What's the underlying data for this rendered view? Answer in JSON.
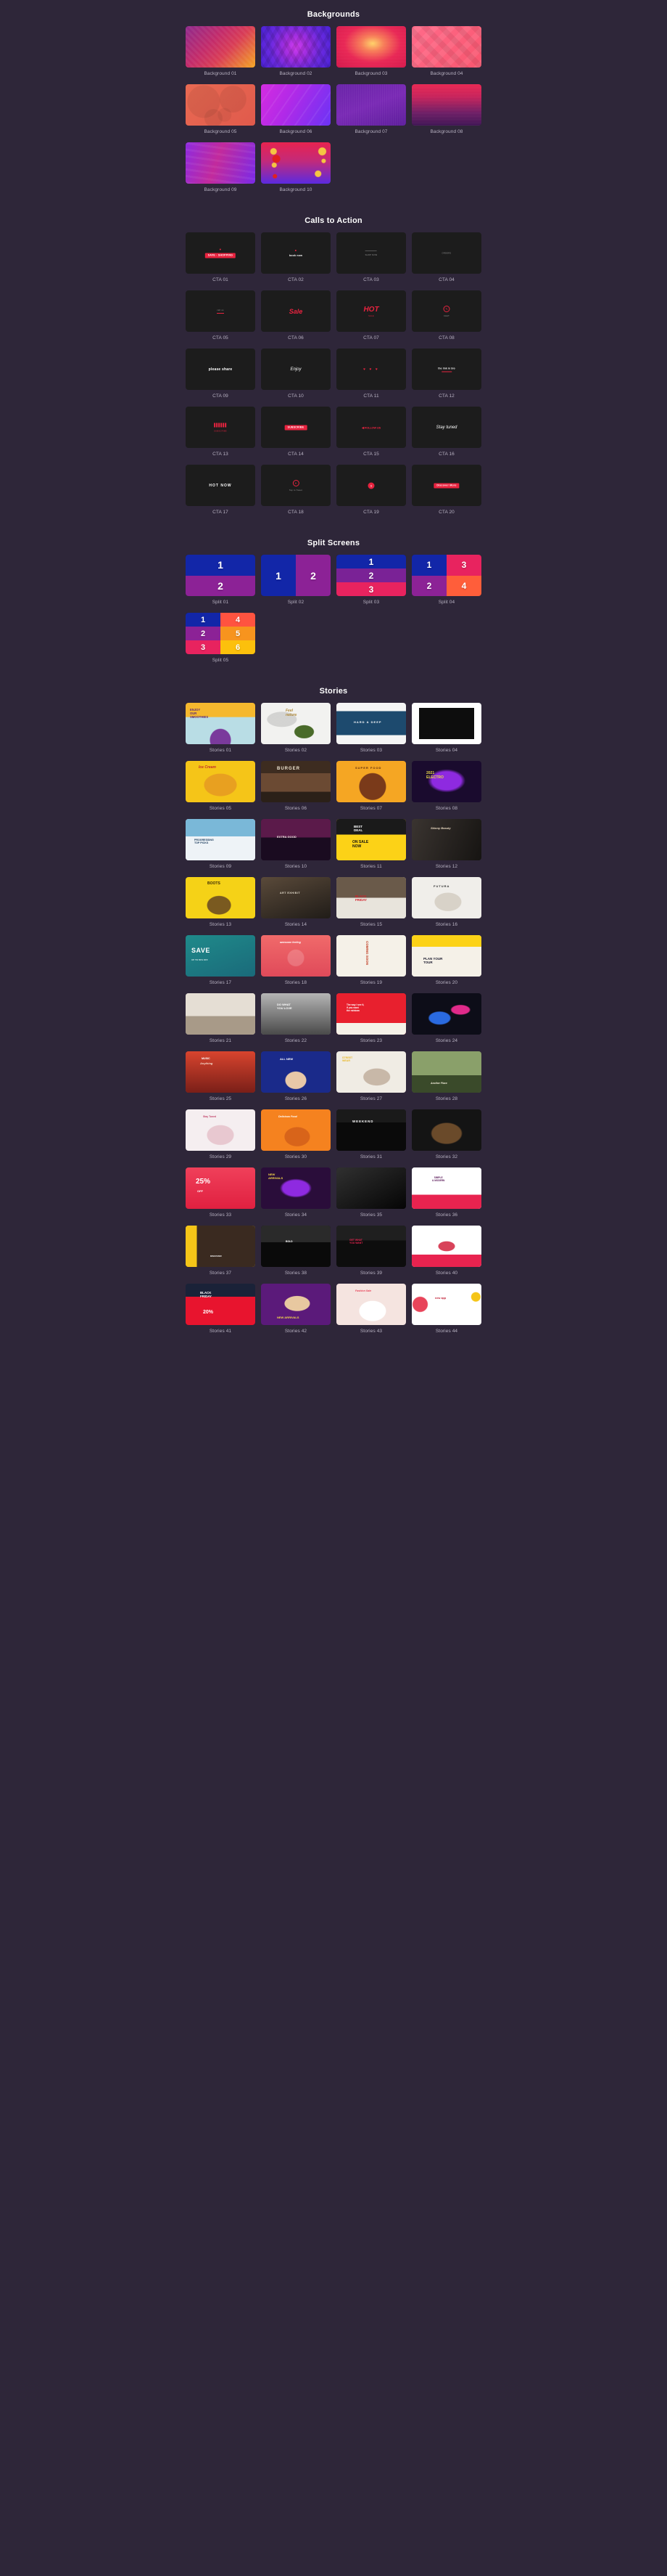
{
  "sections": [
    {
      "id": "backgrounds",
      "title": "Backgrounds",
      "items": [
        {
          "label": "Background 01",
          "kind": "bg",
          "style": "bg01"
        },
        {
          "label": "Background 02",
          "kind": "bg",
          "style": "bg02"
        },
        {
          "label": "Background 03",
          "kind": "bg",
          "style": "bg03"
        },
        {
          "label": "Background 04",
          "kind": "bg",
          "style": "bg04"
        },
        {
          "label": "Background 05",
          "kind": "bg",
          "style": "bg05"
        },
        {
          "label": "Background 06",
          "kind": "bg",
          "style": "bg06"
        },
        {
          "label": "Background 07",
          "kind": "bg",
          "style": "bg07"
        },
        {
          "label": "Background 08",
          "kind": "bg",
          "style": "bg08"
        },
        {
          "label": "Background 09",
          "kind": "bg",
          "style": "bg09"
        },
        {
          "label": "Background 10",
          "kind": "bg",
          "style": "bg10"
        }
      ]
    },
    {
      "id": "calls-to-action",
      "title": "Calls to Action",
      "items": [
        {
          "label": "CTA 01",
          "kind": "cta",
          "mark": "pill",
          "text": "SAVE · SHOPPING"
        },
        {
          "label": "CTA 02",
          "kind": "cta",
          "mark": "dot-text",
          "text": "book now"
        },
        {
          "label": "CTA 03",
          "kind": "cta",
          "mark": "line-sub",
          "text": "SHOP NOW"
        },
        {
          "label": "CTA 04",
          "kind": "cta",
          "mark": "small-caps",
          "text": "ORDERS"
        },
        {
          "label": "CTA 05",
          "kind": "cta",
          "mark": "tiny-line",
          "text": "call us"
        },
        {
          "label": "CTA 06",
          "kind": "cta",
          "mark": "big-italic",
          "text": "Sale"
        },
        {
          "label": "CTA 07",
          "kind": "cta",
          "mark": "stack-red",
          "text": "HOT"
        },
        {
          "label": "CTA 08",
          "kind": "cta",
          "mark": "bubble",
          "text": "CHAT"
        },
        {
          "label": "CTA 09",
          "kind": "cta",
          "mark": "pill-white",
          "text": "please share"
        },
        {
          "label": "CTA 10",
          "kind": "cta",
          "mark": "script",
          "text": "Enjoy"
        },
        {
          "label": "CTA 11",
          "kind": "cta",
          "mark": "hearts",
          "text": "♥ ♥ ♥"
        },
        {
          "label": "CTA 12",
          "kind": "cta",
          "mark": "two-line",
          "text": "the link in bio"
        },
        {
          "label": "CTA 13",
          "kind": "cta",
          "mark": "grid-red",
          "text": "SUBSCRIBE"
        },
        {
          "label": "CTA 14",
          "kind": "cta",
          "mark": "banner",
          "text": "SUBSCRIBE"
        },
        {
          "label": "CTA 15",
          "kind": "cta",
          "mark": "arrow-tag",
          "text": "FOLLOW US"
        },
        {
          "label": "CTA 16",
          "kind": "cta",
          "mark": "script-white",
          "text": "Stay tuned"
        },
        {
          "label": "CTA 17",
          "kind": "cta",
          "mark": "outline",
          "text": "HOT NOW"
        },
        {
          "label": "CTA 18",
          "kind": "cta",
          "mark": "circle-icon",
          "text": "Tap to Tweet"
        },
        {
          "label": "CTA 19",
          "kind": "cta",
          "mark": "bubble-red",
          "text": "SALE"
        },
        {
          "label": "CTA 20",
          "kind": "cta",
          "mark": "stack-sale",
          "text": "Discover More"
        }
      ]
    },
    {
      "id": "split-screens",
      "title": "Split Screens",
      "items": [
        {
          "label": "Split 01",
          "kind": "split",
          "layout": "sp-1",
          "panels": [
            {
              "n": "1",
              "color": "#1226a8"
            },
            {
              "n": "2",
              "color": "#8c2296"
            }
          ]
        },
        {
          "label": "Split 02",
          "kind": "split",
          "layout": "sp-2",
          "panels": [
            {
              "n": "1",
              "color": "#1226a8"
            },
            {
              "n": "2",
              "color": "#8c2296"
            }
          ]
        },
        {
          "label": "Split 03",
          "kind": "split",
          "layout": "sp-3",
          "panels": [
            {
              "n": "1",
              "color": "#1226a8"
            },
            {
              "n": "2",
              "color": "#7a2296"
            },
            {
              "n": "3",
              "color": "#e8235f"
            }
          ]
        },
        {
          "label": "Split 04",
          "kind": "split",
          "layout": "sp-4",
          "panels": [
            {
              "n": "1",
              "color": "#1226a8"
            },
            {
              "n": "3",
              "color": "#e8235f"
            },
            {
              "n": "2",
              "color": "#8c2296"
            },
            {
              "n": "4",
              "color": "#ff5e3a"
            }
          ]
        },
        {
          "label": "Split 05",
          "kind": "split",
          "layout": "sp-5",
          "panels": [
            {
              "n": "1",
              "color": "#1226a8"
            },
            {
              "n": "4",
              "color": "#ff5340"
            },
            {
              "n": "2",
              "color": "#8c2296"
            },
            {
              "n": "5",
              "color": "#f7941e"
            },
            {
              "n": "3",
              "color": "#e8235f"
            },
            {
              "n": "6",
              "color": "#fcc00c"
            }
          ]
        }
      ]
    },
    {
      "id": "stories",
      "title": "Stories",
      "items": [
        {
          "label": "Stories 01",
          "kind": "story",
          "style": "s01",
          "text": "ENJOY OUR SMOOTHIES"
        },
        {
          "label": "Stories 02",
          "kind": "story",
          "style": "s02",
          "text": "Feel nature"
        },
        {
          "label": "Stories 03",
          "kind": "story",
          "style": "s03",
          "text": "HARD & DEEP"
        },
        {
          "label": "Stories 04",
          "kind": "story",
          "style": "s04",
          "text": ""
        },
        {
          "label": "Stories 05",
          "kind": "story",
          "style": "s05",
          "text": "Ice Cream"
        },
        {
          "label": "Stories 06",
          "kind": "story",
          "style": "s06",
          "text": "BURGER"
        },
        {
          "label": "Stories 07",
          "kind": "story",
          "style": "s07",
          "text": "FOOD"
        },
        {
          "label": "Stories 08",
          "kind": "story",
          "style": "s08",
          "text": "2021 ELECTRO MUSIC"
        },
        {
          "label": "Stories 09",
          "kind": "story",
          "style": "s09",
          "text": "PROGRESSING TOP PICKS"
        },
        {
          "label": "Stories 10",
          "kind": "story",
          "style": "s10",
          "text": "EXTRA GOOD BUSINESS"
        },
        {
          "label": "Stories 11",
          "kind": "story",
          "style": "s11",
          "text": "BEST DEAL ON SALE NOW"
        },
        {
          "label": "Stories 12",
          "kind": "story",
          "style": "s12",
          "text": "Skinny Beauty"
        },
        {
          "label": "Stories 13",
          "kind": "story",
          "style": "s13",
          "text": "BOOTS"
        },
        {
          "label": "Stories 14",
          "kind": "story",
          "style": "s14",
          "text": "ART EXHIBIT"
        },
        {
          "label": "Stories 15",
          "kind": "story",
          "style": "s15",
          "text": "BLACK FRIDAY"
        },
        {
          "label": "Stories 16",
          "kind": "story",
          "style": "s16",
          "text": "FUTURA"
        },
        {
          "label": "Stories 17",
          "kind": "story",
          "style": "s17",
          "text": "SAVE"
        },
        {
          "label": "Stories 18",
          "kind": "story",
          "style": "s18",
          "text": "awesome feeling"
        },
        {
          "label": "Stories 19",
          "kind": "story",
          "style": "s19",
          "text": "COMING SOON"
        },
        {
          "label": "Stories 20",
          "kind": "story",
          "style": "s20",
          "text": "PLAN YOUR TOUR"
        },
        {
          "label": "Stories 21",
          "kind": "story",
          "style": "s21",
          "text": ""
        },
        {
          "label": "Stories 22",
          "kind": "story",
          "style": "s22",
          "text": "DO WHAT YOU LOVE"
        },
        {
          "label": "Stories 23",
          "kind": "story",
          "style": "s23",
          "text": "The way I see it, if you want the rainbow"
        },
        {
          "label": "Stories 24",
          "kind": "story",
          "style": "s24",
          "text": ""
        },
        {
          "label": "Stories 25",
          "kind": "story",
          "style": "s25",
          "text": "MUSIC Anything"
        },
        {
          "label": "Stories 26",
          "kind": "story",
          "style": "s26",
          "text": "ALL NEW"
        },
        {
          "label": "Stories 27",
          "kind": "story",
          "style": "s27",
          "text": "STREET WEAR"
        },
        {
          "label": "Stories 28",
          "kind": "story",
          "style": "s28",
          "text": "Another Place"
        },
        {
          "label": "Stories 29",
          "kind": "story",
          "style": "s29",
          "text": "Stay Tuned"
        },
        {
          "label": "Stories 30",
          "kind": "story",
          "style": "s30",
          "text": "Delicious Food"
        },
        {
          "label": "Stories 31",
          "kind": "story",
          "style": "s31",
          "text": "WEEKEND"
        },
        {
          "label": "Stories 32",
          "kind": "story",
          "style": "s32",
          "text": ""
        },
        {
          "label": "Stories 33",
          "kind": "story",
          "style": "s33",
          "text": "25% OFF"
        },
        {
          "label": "Stories 34",
          "kind": "story",
          "style": "s34",
          "text": "NEW ARRIVALS"
        },
        {
          "label": "Stories 35",
          "kind": "story",
          "style": "s35",
          "text": ""
        },
        {
          "label": "Stories 36",
          "kind": "story",
          "style": "s36",
          "text": "SIMPLE & MODERN"
        },
        {
          "label": "Stories 37",
          "kind": "story",
          "style": "s37",
          "text": ""
        },
        {
          "label": "Stories 38",
          "kind": "story",
          "style": "s38",
          "text": ""
        },
        {
          "label": "Stories 39",
          "kind": "story",
          "style": "s39",
          "text": "GET WHAT YOU WANT"
        },
        {
          "label": "Stories 40",
          "kind": "story",
          "style": "s40",
          "text": ""
        },
        {
          "label": "Stories 41",
          "kind": "story",
          "style": "s41",
          "text": "BLACK FRIDAY 20%"
        },
        {
          "label": "Stories 42",
          "kind": "story",
          "style": "s42",
          "text": "NEW ARRIVALS"
        },
        {
          "label": "Stories 43",
          "kind": "story",
          "style": "s43",
          "text": "Fashion Sale"
        },
        {
          "label": "Stories 44",
          "kind": "story",
          "style": "s44",
          "text": "new app"
        }
      ]
    }
  ]
}
